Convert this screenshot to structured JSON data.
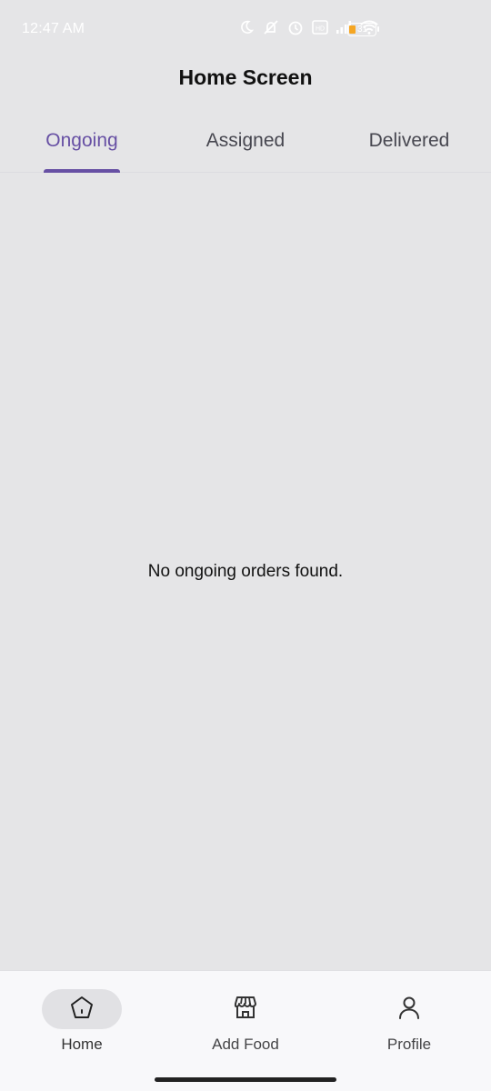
{
  "status_bar": {
    "time": "12:47 AM",
    "battery_level": "31",
    "icons": [
      "moon-icon",
      "muted-icon",
      "alarm-icon",
      "hd-icon",
      "signal-icon",
      "wifi-icon",
      "battery-icon"
    ]
  },
  "app_bar": {
    "title": "Home Screen"
  },
  "tabs": [
    {
      "label": "Ongoing",
      "active": true
    },
    {
      "label": "Assigned",
      "active": false
    },
    {
      "label": "Delivered",
      "active": false
    }
  ],
  "content": {
    "empty_message": "No ongoing orders found."
  },
  "bottom_nav": {
    "items": [
      {
        "label": "Home",
        "icon": "home-icon",
        "active": true
      },
      {
        "label": "Add Food",
        "icon": "store-icon",
        "active": false
      },
      {
        "label": "Profile",
        "icon": "person-icon",
        "active": false
      }
    ]
  },
  "colors": {
    "accent": "#6750a4",
    "background": "#e5e5e7",
    "nav_background": "#f8f8fa"
  }
}
